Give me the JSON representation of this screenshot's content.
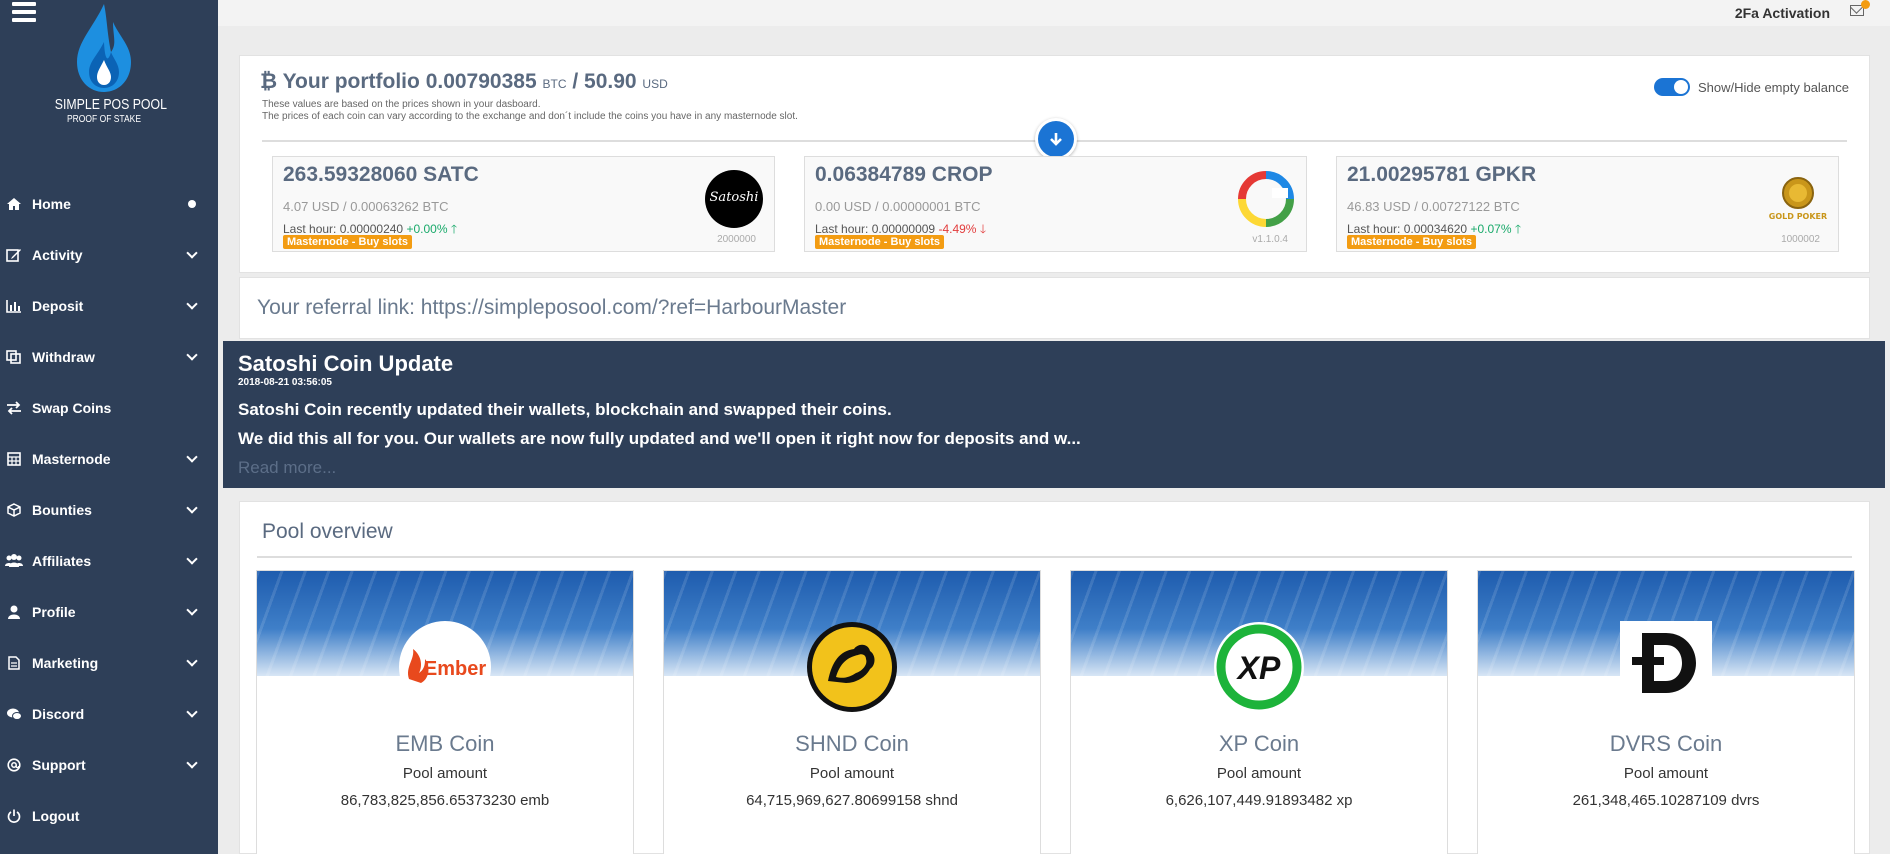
{
  "sidebar": {
    "logo_name": "SIMPLE POS POOL",
    "logo_sub": "PROOF OF STAKE",
    "items": [
      {
        "label": "Home",
        "icon": "home-icon"
      },
      {
        "label": "Activity",
        "icon": "edit-icon"
      },
      {
        "label": "Deposit",
        "icon": "bar-chart-icon"
      },
      {
        "label": "Withdraw",
        "icon": "copy-icon"
      },
      {
        "label": "Swap Coins",
        "icon": "exchange-icon"
      },
      {
        "label": "Masternode",
        "icon": "calculator-icon"
      },
      {
        "label": "Bounties",
        "icon": "cube-icon"
      },
      {
        "label": "Affiliates",
        "icon": "users-icon"
      },
      {
        "label": "Profile",
        "icon": "user-icon"
      },
      {
        "label": "Marketing",
        "icon": "file-icon"
      },
      {
        "label": "Discord",
        "icon": "chat-icon"
      },
      {
        "label": "Support",
        "icon": "at-icon"
      },
      {
        "label": "Logout",
        "icon": "power-icon"
      }
    ]
  },
  "topbar": {
    "twofa": "2Fa Activation",
    "mail_icon": "envelope-icon"
  },
  "portfolio": {
    "label": "Your portfolio",
    "btc_value": "0.00790385",
    "btc_unit": "BTC",
    "separator": "/",
    "usd_value": "50.90",
    "usd_unit": "USD",
    "note1": "These values are based on the prices shown in your dasboard.",
    "note2": "The prices of each coin can vary according to the exchange and don´t include the coins you have in any masternode slot.",
    "toggle_label": "Show/Hide empty balance",
    "coins": [
      {
        "amount": "263.59328060 SATC",
        "usd": "4.07 USD / 0.00063262 BTC",
        "hour_label": "Last hour: 0.00000240",
        "change": "+0.00%",
        "badge": "Masternode - Buy slots",
        "sub": "2000000",
        "logo_text": "Satoshi"
      },
      {
        "amount": "0.06384789 CROP",
        "usd": "0.00 USD / 0.00000001 BTC",
        "hour_label": "Last hour: 0.00000009",
        "change": "-4.49%",
        "badge": "Masternode - Buy slots",
        "sub": "v1.1.0.4"
      },
      {
        "amount": "21.00295781 GPKR",
        "usd": "46.83 USD / 0.00727122 BTC",
        "hour_label": "Last hour: 0.00034620",
        "change": "+0.07%",
        "badge": "Masternode - Buy slots",
        "sub": "1000002",
        "logo_text": "GOLD POKER"
      }
    ]
  },
  "referral": {
    "text": "Your referral link: https://simpleposool.com/?ref=HarbourMaster"
  },
  "news": {
    "title": "Satoshi Coin Update",
    "date": "2018-08-21 03:56:05",
    "line1": "Satoshi Coin recently updated their wallets, blockchain and swapped their coins.",
    "line2": "We did this all for you. Our wallets are now fully updated and we'll open it right now for deposits and w...",
    "more": "Read more..."
  },
  "pool": {
    "title": "Pool overview",
    "cards": [
      {
        "name": "EMB Coin",
        "label": "Pool amount",
        "amount": "86,783,825,856.65373230 emb",
        "logo_text": "Ember"
      },
      {
        "name": "SHND Coin",
        "label": "Pool amount",
        "amount": "64,715,969,627.80699158 shnd"
      },
      {
        "name": "XP Coin",
        "label": "Pool amount",
        "amount": "6,626,107,449.91893482 xp",
        "logo_text": "XP"
      },
      {
        "name": "DVRS Coin",
        "label": "Pool amount",
        "amount": "261,348,465.10287109 dvrs"
      }
    ]
  },
  "colors": {
    "sidebar": "#2e3f58",
    "accent": "#1b74d4",
    "badge": "#f39c12",
    "up": "#1aaa6b",
    "down": "#e23c3c"
  }
}
